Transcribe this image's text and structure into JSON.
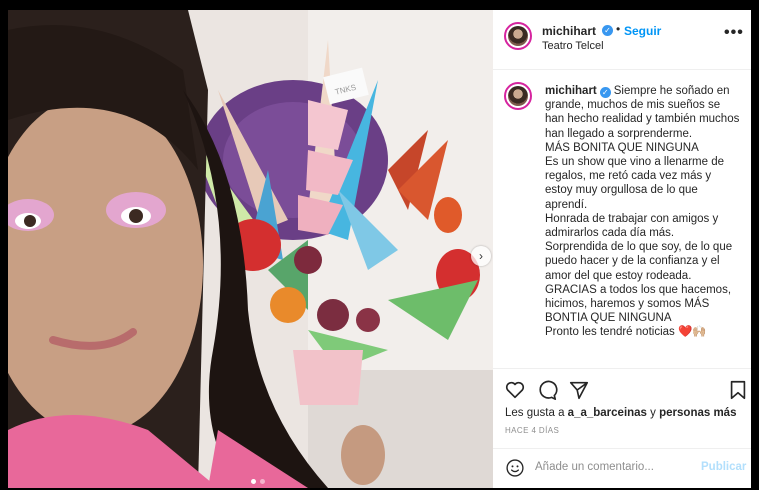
{
  "post": {
    "username": "michihart",
    "follow_label": "Seguir",
    "separator": "•",
    "location": "Teatro Telcel",
    "more_icon": "•••",
    "caption": {
      "username": "michihart",
      "text": "Siempre he soñado en grande, muchos de mis sueños se han hecho realidad y también muchos han llegado a sorprenderme.\nMÁS BONITA QUE NINGUNA\nEs un show que vino a llenarme de regalos, me retó cada vez más y estoy muy orgullosa de lo que aprendí.\nHonrada de trabajar con amigos y admirarlos cada día más.\nSorprendida de lo que soy, de lo que puedo hacer y de la confianza y el amor del que estoy rodeada.\nGRACIAS a todos los que hacemos, hicimos, haremos y somos MÁS BONTIA QUE NINGUNA\nPronto les tendré noticias ❤️🙌🏼"
    },
    "likes": {
      "prefix": "Les gusta a",
      "user": "a_a_barceinas",
      "joiner": "y",
      "others": "personas más"
    },
    "timestamp": "HACE 4 DÍAS",
    "comment": {
      "placeholder": "Añade un comentario...",
      "publish_label": "Publicar"
    },
    "photo": {
      "card_text": "TNKS",
      "carousel_total": 2,
      "carousel_active": 1
    },
    "colors": {
      "accent": "#0095f6",
      "publish_disabled": "#b2dffc",
      "verified": "#3897f0"
    },
    "icons": [
      "heart-icon",
      "comment-icon",
      "share-icon",
      "bookmark-icon",
      "emoji-icon",
      "chevron-right-icon"
    ]
  }
}
